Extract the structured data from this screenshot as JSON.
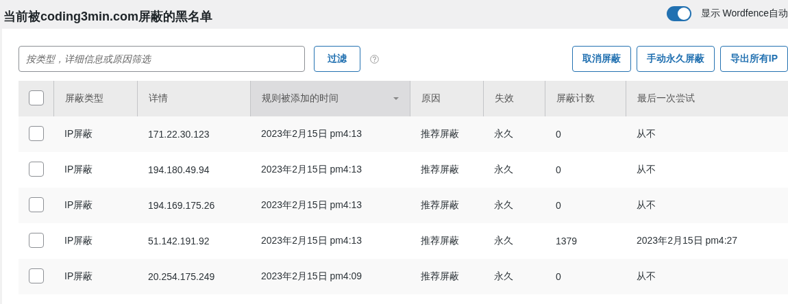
{
  "page_title": "当前被coding3min.com屏蔽的黑名单",
  "toggle": {
    "on": true,
    "label": "显示 Wordfence自动"
  },
  "filter": {
    "placeholder": "按类型，详细信息或原因筛选",
    "button": "过滤"
  },
  "actions": [
    "取消屏蔽",
    "手动永久屏蔽",
    "导出所有IP"
  ],
  "table": {
    "select_all": {
      "checked": false
    },
    "columns": [
      {
        "label": "屏蔽类型",
        "sorted": false
      },
      {
        "label": "详情",
        "sorted": false
      },
      {
        "label": "规则被添加的时间",
        "sorted": true
      },
      {
        "label": "原因",
        "sorted": false
      },
      {
        "label": "失效",
        "sorted": false
      },
      {
        "label": "屏蔽计数",
        "sorted": false
      },
      {
        "label": "最后一次尝试",
        "sorted": false
      }
    ],
    "rows": [
      {
        "checked": false,
        "cells": [
          "IP屏蔽",
          "171.22.30.123",
          "2023年2月15日 pm4:13",
          "推荐屏蔽",
          "永久",
          "0",
          "从不"
        ]
      },
      {
        "checked": false,
        "cells": [
          "IP屏蔽",
          "194.180.49.94",
          "2023年2月15日 pm4:13",
          "推荐屏蔽",
          "永久",
          "0",
          "从不"
        ]
      },
      {
        "checked": false,
        "cells": [
          "IP屏蔽",
          "194.169.175.26",
          "2023年2月15日 pm4:13",
          "推荐屏蔽",
          "永久",
          "0",
          "从不"
        ]
      },
      {
        "checked": false,
        "cells": [
          "IP屏蔽",
          "51.142.191.92",
          "2023年2月15日 pm4:13",
          "推荐屏蔽",
          "永久",
          "1379",
          "2023年2月15日 pm4:27"
        ]
      },
      {
        "checked": false,
        "cells": [
          "IP屏蔽",
          "20.254.175.249",
          "2023年2月15日 pm4:09",
          "推荐屏蔽",
          "永久",
          "0",
          "从不"
        ]
      }
    ]
  }
}
